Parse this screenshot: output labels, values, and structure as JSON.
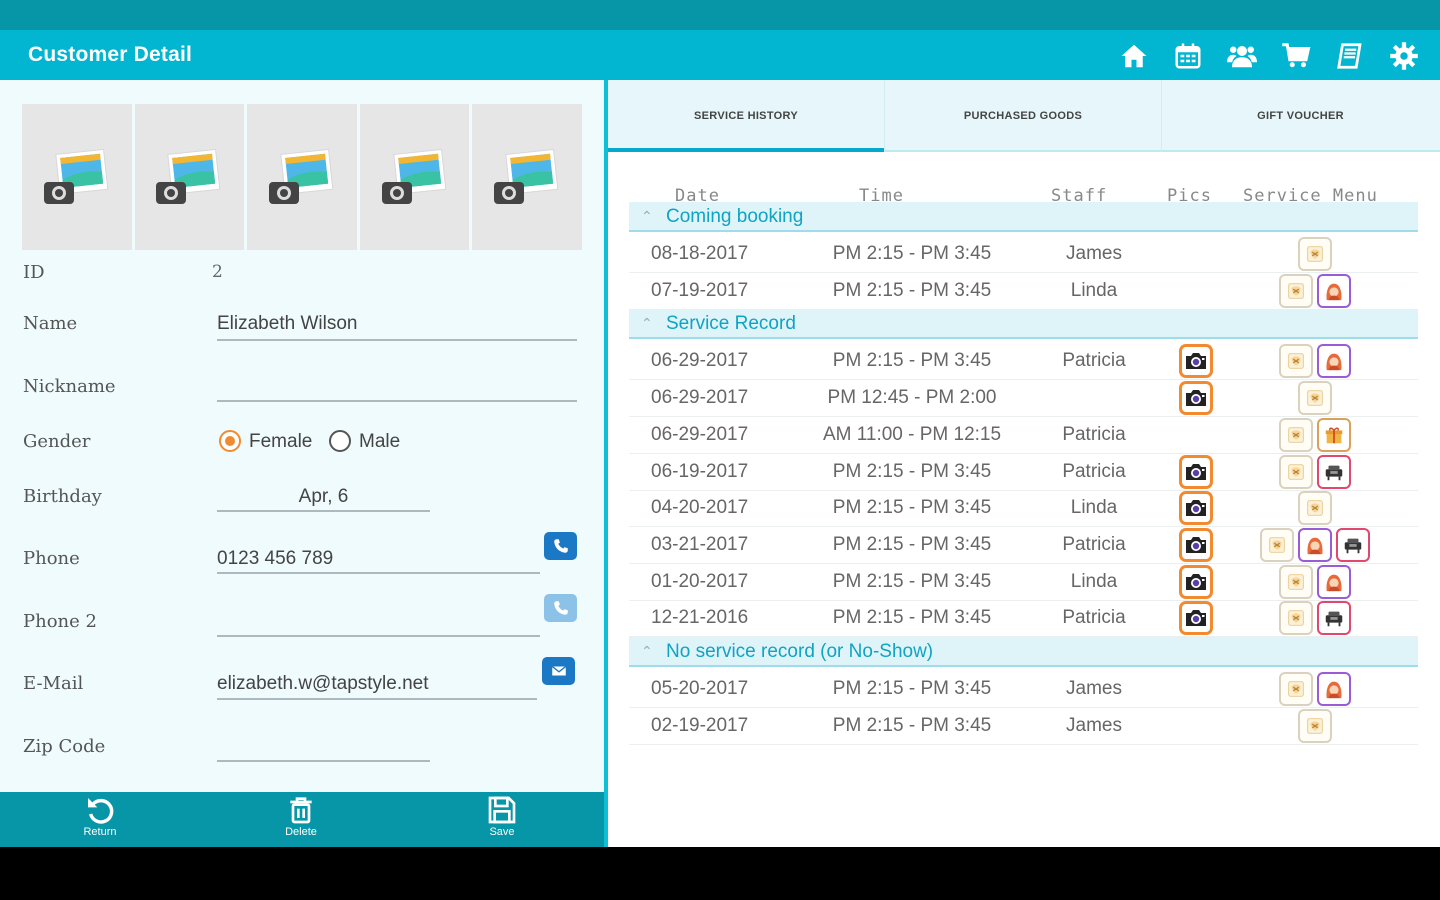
{
  "app": {
    "title": "Customer Detail"
  },
  "appbar_icons": [
    "home-icon",
    "calendar-icon",
    "customers-icon",
    "cart-icon",
    "book-icon",
    "settings-icon"
  ],
  "colors": {
    "accent": "#02b6d2",
    "dark_accent": "#0796a7",
    "orange": "#f28a2f",
    "section_title": "#0fa3c4"
  },
  "customer": {
    "id_label": "ID",
    "id": "2",
    "name_label": "Name",
    "name": "Elizabeth Wilson",
    "nickname_label": "Nickname",
    "nickname": "",
    "gender_label": "Gender",
    "gender_female": "Female",
    "gender_male": "Male",
    "gender_selected": "Female",
    "birthday_label": "Birthday",
    "birthday": "Apr, 6",
    "phone_label": "Phone",
    "phone": "0123 456 789",
    "phone2_label": "Phone 2",
    "phone2": "",
    "email_label": "E-Mail",
    "email": "elizabeth.w@tapstyle.net",
    "zip_label": "Zip Code",
    "zip": ""
  },
  "bottom_actions": {
    "return": "Return",
    "delete": "Delete",
    "save": "Save"
  },
  "tabs": [
    {
      "label": "SERVICE HISTORY",
      "active": true
    },
    {
      "label": "PURCHASED GOODS",
      "active": false
    },
    {
      "label": "GIFT VOUCHER",
      "active": false
    }
  ],
  "table": {
    "headers": {
      "date": "Date",
      "time": "Time",
      "staff": "Staff",
      "pics": "Pics",
      "menu": "Service Menu"
    },
    "sections": [
      {
        "title": "Coming booking",
        "rows": [
          {
            "date": "08-18-2017",
            "time": "PM 2:15 - PM 3:45",
            "staff": "James",
            "pic": false,
            "menu": [
              "cut"
            ]
          },
          {
            "date": "07-19-2017",
            "time": "PM 2:15 - PM 3:45",
            "staff": "Linda",
            "pic": false,
            "menu": [
              "cut",
              "hair"
            ]
          }
        ]
      },
      {
        "title": "Service Record",
        "rows": [
          {
            "date": "06-29-2017",
            "time": "PM 2:15 - PM 3:45",
            "staff": "Patricia",
            "pic": true,
            "menu": [
              "cut",
              "hair"
            ]
          },
          {
            "date": "06-29-2017",
            "time": "PM 12:45 - PM 2:00",
            "staff": "",
            "pic": true,
            "menu": [
              "cut"
            ]
          },
          {
            "date": "06-29-2017",
            "time": "AM 11:00 - PM 12:15",
            "staff": "Patricia",
            "pic": false,
            "menu": [
              "cut",
              "gift"
            ]
          },
          {
            "date": "06-19-2017",
            "time": "PM 2:15 - PM 3:45",
            "staff": "Patricia",
            "pic": true,
            "menu": [
              "cut",
              "chair"
            ]
          },
          {
            "date": "04-20-2017",
            "time": "PM 2:15 - PM 3:45",
            "staff": "Linda",
            "pic": true,
            "menu": [
              "cut"
            ]
          },
          {
            "date": "03-21-2017",
            "time": "PM 2:15 - PM 3:45",
            "staff": "Patricia",
            "pic": true,
            "menu": [
              "cut",
              "hair",
              "chair"
            ]
          },
          {
            "date": "01-20-2017",
            "time": "PM 2:15 - PM 3:45",
            "staff": "Linda",
            "pic": true,
            "menu": [
              "cut",
              "hair"
            ]
          },
          {
            "date": "12-21-2016",
            "time": "PM 2:15 - PM 3:45",
            "staff": "Patricia",
            "pic": true,
            "menu": [
              "cut",
              "chair"
            ]
          }
        ]
      },
      {
        "title": "No service record (or No-Show)",
        "rows": [
          {
            "date": "05-20-2017",
            "time": "PM 2:15 - PM 3:45",
            "staff": "James",
            "pic": false,
            "menu": [
              "cut",
              "hair"
            ]
          },
          {
            "date": "02-19-2017",
            "time": "PM 2:15 - PM 3:45",
            "staff": "James",
            "pic": false,
            "menu": [
              "cut"
            ]
          }
        ]
      }
    ]
  }
}
